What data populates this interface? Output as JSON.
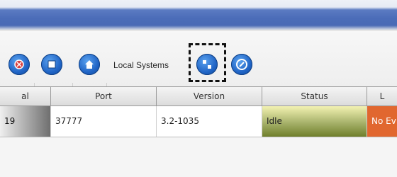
{
  "toolbar": {
    "label": "Local Systems",
    "buttons": [
      {
        "name": "stop-icon",
        "color": "#d94141"
      },
      {
        "name": "square-icon",
        "color": "#ffffff"
      },
      {
        "name": "home-icon",
        "color": "#ffffff"
      },
      {
        "name": "connect-icon",
        "color": "#ffffff"
      },
      {
        "name": "compass-icon",
        "color": "#ffffff"
      }
    ]
  },
  "table": {
    "columns": [
      "al",
      "Port",
      "Version",
      "Status",
      "L"
    ],
    "rows": [
      {
        "col1": "19",
        "port": "37777",
        "version": "3.2-1035",
        "status": "Idle",
        "last": "No Ev"
      }
    ]
  },
  "colors": {
    "title_blue": "#4a6ab5",
    "idle_gradient_from": "#f3f2b2",
    "idle_gradient_to": "#6f7f2b",
    "orange_cell": "#e1672f"
  }
}
